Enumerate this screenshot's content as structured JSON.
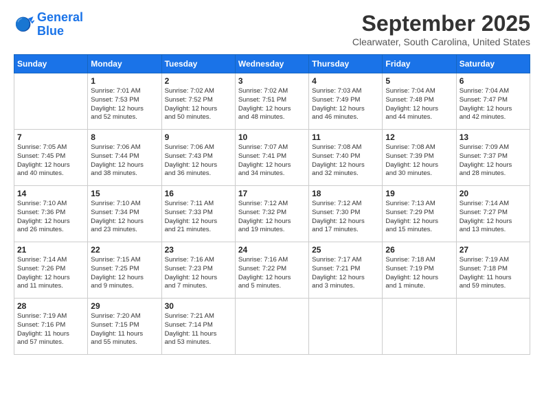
{
  "header": {
    "logo_line1": "General",
    "logo_line2": "Blue",
    "month": "September 2025",
    "location": "Clearwater, South Carolina, United States"
  },
  "weekdays": [
    "Sunday",
    "Monday",
    "Tuesday",
    "Wednesday",
    "Thursday",
    "Friday",
    "Saturday"
  ],
  "weeks": [
    [
      {
        "day": "",
        "info": ""
      },
      {
        "day": "1",
        "info": "Sunrise: 7:01 AM\nSunset: 7:53 PM\nDaylight: 12 hours\nand 52 minutes."
      },
      {
        "day": "2",
        "info": "Sunrise: 7:02 AM\nSunset: 7:52 PM\nDaylight: 12 hours\nand 50 minutes."
      },
      {
        "day": "3",
        "info": "Sunrise: 7:02 AM\nSunset: 7:51 PM\nDaylight: 12 hours\nand 48 minutes."
      },
      {
        "day": "4",
        "info": "Sunrise: 7:03 AM\nSunset: 7:49 PM\nDaylight: 12 hours\nand 46 minutes."
      },
      {
        "day": "5",
        "info": "Sunrise: 7:04 AM\nSunset: 7:48 PM\nDaylight: 12 hours\nand 44 minutes."
      },
      {
        "day": "6",
        "info": "Sunrise: 7:04 AM\nSunset: 7:47 PM\nDaylight: 12 hours\nand 42 minutes."
      }
    ],
    [
      {
        "day": "7",
        "info": "Sunrise: 7:05 AM\nSunset: 7:45 PM\nDaylight: 12 hours\nand 40 minutes."
      },
      {
        "day": "8",
        "info": "Sunrise: 7:06 AM\nSunset: 7:44 PM\nDaylight: 12 hours\nand 38 minutes."
      },
      {
        "day": "9",
        "info": "Sunrise: 7:06 AM\nSunset: 7:43 PM\nDaylight: 12 hours\nand 36 minutes."
      },
      {
        "day": "10",
        "info": "Sunrise: 7:07 AM\nSunset: 7:41 PM\nDaylight: 12 hours\nand 34 minutes."
      },
      {
        "day": "11",
        "info": "Sunrise: 7:08 AM\nSunset: 7:40 PM\nDaylight: 12 hours\nand 32 minutes."
      },
      {
        "day": "12",
        "info": "Sunrise: 7:08 AM\nSunset: 7:39 PM\nDaylight: 12 hours\nand 30 minutes."
      },
      {
        "day": "13",
        "info": "Sunrise: 7:09 AM\nSunset: 7:37 PM\nDaylight: 12 hours\nand 28 minutes."
      }
    ],
    [
      {
        "day": "14",
        "info": "Sunrise: 7:10 AM\nSunset: 7:36 PM\nDaylight: 12 hours\nand 26 minutes."
      },
      {
        "day": "15",
        "info": "Sunrise: 7:10 AM\nSunset: 7:34 PM\nDaylight: 12 hours\nand 23 minutes."
      },
      {
        "day": "16",
        "info": "Sunrise: 7:11 AM\nSunset: 7:33 PM\nDaylight: 12 hours\nand 21 minutes."
      },
      {
        "day": "17",
        "info": "Sunrise: 7:12 AM\nSunset: 7:32 PM\nDaylight: 12 hours\nand 19 minutes."
      },
      {
        "day": "18",
        "info": "Sunrise: 7:12 AM\nSunset: 7:30 PM\nDaylight: 12 hours\nand 17 minutes."
      },
      {
        "day": "19",
        "info": "Sunrise: 7:13 AM\nSunset: 7:29 PM\nDaylight: 12 hours\nand 15 minutes."
      },
      {
        "day": "20",
        "info": "Sunrise: 7:14 AM\nSunset: 7:27 PM\nDaylight: 12 hours\nand 13 minutes."
      }
    ],
    [
      {
        "day": "21",
        "info": "Sunrise: 7:14 AM\nSunset: 7:26 PM\nDaylight: 12 hours\nand 11 minutes."
      },
      {
        "day": "22",
        "info": "Sunrise: 7:15 AM\nSunset: 7:25 PM\nDaylight: 12 hours\nand 9 minutes."
      },
      {
        "day": "23",
        "info": "Sunrise: 7:16 AM\nSunset: 7:23 PM\nDaylight: 12 hours\nand 7 minutes."
      },
      {
        "day": "24",
        "info": "Sunrise: 7:16 AM\nSunset: 7:22 PM\nDaylight: 12 hours\nand 5 minutes."
      },
      {
        "day": "25",
        "info": "Sunrise: 7:17 AM\nSunset: 7:21 PM\nDaylight: 12 hours\nand 3 minutes."
      },
      {
        "day": "26",
        "info": "Sunrise: 7:18 AM\nSunset: 7:19 PM\nDaylight: 12 hours\nand 1 minute."
      },
      {
        "day": "27",
        "info": "Sunrise: 7:19 AM\nSunset: 7:18 PM\nDaylight: 11 hours\nand 59 minutes."
      }
    ],
    [
      {
        "day": "28",
        "info": "Sunrise: 7:19 AM\nSunset: 7:16 PM\nDaylight: 11 hours\nand 57 minutes."
      },
      {
        "day": "29",
        "info": "Sunrise: 7:20 AM\nSunset: 7:15 PM\nDaylight: 11 hours\nand 55 minutes."
      },
      {
        "day": "30",
        "info": "Sunrise: 7:21 AM\nSunset: 7:14 PM\nDaylight: 11 hours\nand 53 minutes."
      },
      {
        "day": "",
        "info": ""
      },
      {
        "day": "",
        "info": ""
      },
      {
        "day": "",
        "info": ""
      },
      {
        "day": "",
        "info": ""
      }
    ]
  ]
}
